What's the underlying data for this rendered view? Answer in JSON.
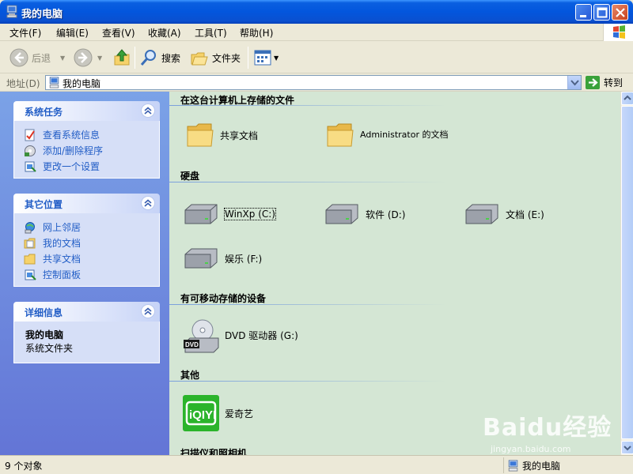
{
  "window": {
    "title": "我的电脑"
  },
  "menu": [
    "文件(F)",
    "编辑(E)",
    "查看(V)",
    "收藏(A)",
    "工具(T)",
    "帮助(H)"
  ],
  "toolbar": {
    "back": "后退",
    "search": "搜索",
    "folders": "文件夹"
  },
  "address": {
    "label": "地址(D)",
    "value": "我的电脑",
    "go": "转到"
  },
  "left": {
    "system_tasks": {
      "title": "系统任务",
      "items": [
        "查看系统信息",
        "添加/删除程序",
        "更改一个设置"
      ]
    },
    "other_places": {
      "title": "其它位置",
      "items": [
        "网上邻居",
        "我的文档",
        "共享文档",
        "控制面板"
      ]
    },
    "details": {
      "title": "详细信息",
      "name": "我的电脑",
      "type": "系统文件夹"
    }
  },
  "groups": {
    "files": "在这台计算机上存储的文件",
    "hdd": "硬盘",
    "removable": "有可移动存储的设备",
    "other": "其他",
    "scanners": "扫描仪和照相机"
  },
  "items": {
    "shared_docs": "共享文档",
    "admin_docs": "Administrator 的文档",
    "drive_c": "WinXp (C:)",
    "drive_d": "软件 (D:)",
    "drive_e": "文档 (E:)",
    "drive_f": "娱乐 (F:)",
    "dvd": "DVD 驱动器 (G:)",
    "iqiyi": "爱奇艺",
    "iqiyi_logo": "iQIYI"
  },
  "status": {
    "count": "9 个对象",
    "location": "我的电脑"
  },
  "watermark": {
    "brand": "Baidu经验",
    "url": "jingyan.baidu.com"
  }
}
